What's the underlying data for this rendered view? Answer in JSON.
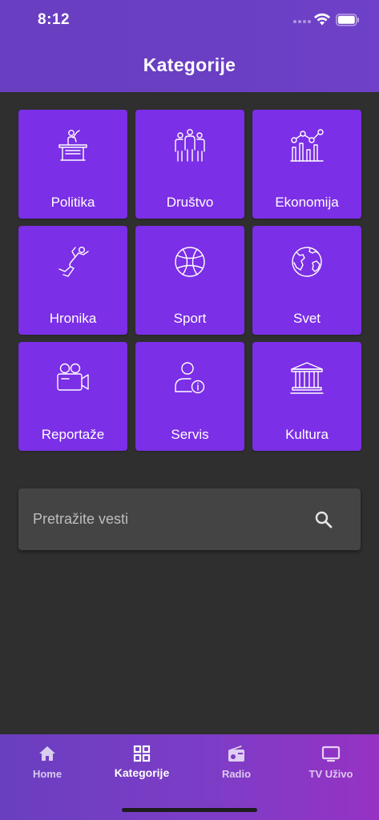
{
  "status_bar": {
    "time": "8:12"
  },
  "header": {
    "title": "Kategorije"
  },
  "categories": [
    {
      "label": "Politika",
      "icon": "speaker-podium-icon"
    },
    {
      "label": "Društvo",
      "icon": "group-people-icon"
    },
    {
      "label": "Ekonomija",
      "icon": "economy-chart-icon"
    },
    {
      "label": "Hronika",
      "icon": "crime-scene-body-icon"
    },
    {
      "label": "Sport",
      "icon": "basketball-icon"
    },
    {
      "label": "Svet",
      "icon": "globe-icon"
    },
    {
      "label": "Reportaže",
      "icon": "video-camera-icon"
    },
    {
      "label": "Servis",
      "icon": "user-info-icon"
    },
    {
      "label": "Kultura",
      "icon": "temple-icon"
    }
  ],
  "search": {
    "placeholder": "Pretražite vesti"
  },
  "bottom_nav": {
    "active": "Kategorije",
    "items": [
      {
        "label": "Home",
        "icon": "home-icon"
      },
      {
        "label": "Kategorije",
        "icon": "grid-icon"
      },
      {
        "label": "Radio",
        "icon": "radio-icon"
      },
      {
        "label": "TV Uživo",
        "icon": "tv-icon"
      }
    ]
  },
  "colors": {
    "header": "#6a3ec0",
    "tile": "#7b2fe6",
    "background": "#2f2f2f",
    "search_bar": "#444444"
  }
}
